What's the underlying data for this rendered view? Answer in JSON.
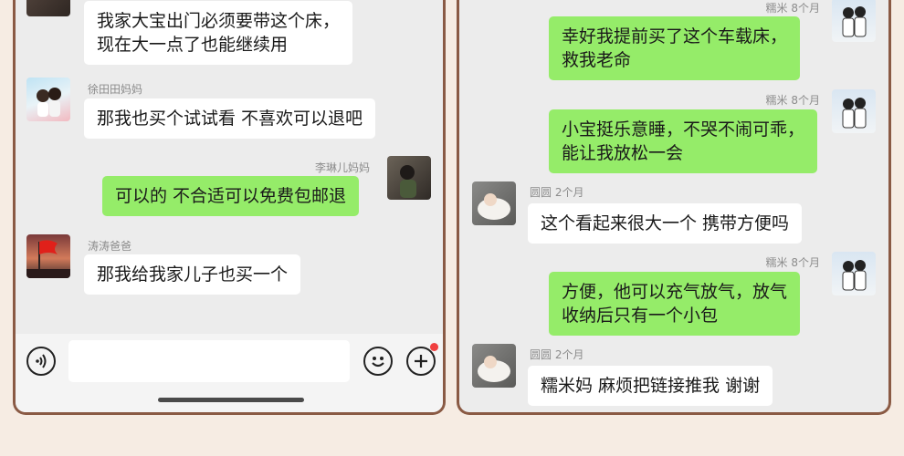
{
  "left_chat": {
    "messages": [
      {
        "sender": "",
        "text_lines": [
          "我家大宝出门必须要带这个床，",
          "现在大一点了也能继续用"
        ],
        "side": "left"
      },
      {
        "sender": "徐田田妈妈",
        "text": "那我也买个试试看 不喜欢可以退吧",
        "side": "left"
      },
      {
        "sender": "李琳儿妈妈",
        "text": "可以的 不合适可以免费包邮退",
        "side": "right"
      },
      {
        "sender": "涛涛爸爸",
        "text": "那我给我家儿子也买一个",
        "side": "left"
      }
    ],
    "input": {
      "placeholder": ""
    }
  },
  "right_chat": {
    "messages": [
      {
        "sender": "糯米 8个月",
        "text_lines": [
          "幸好我提前买了这个车载床，",
          "救我老命"
        ],
        "side": "right"
      },
      {
        "sender": "糯米 8个月",
        "text_lines": [
          "小宝挺乐意睡，不哭不闹可乖，",
          "能让我放松一会"
        ],
        "side": "right"
      },
      {
        "sender": "圆圆  2个月",
        "text": "这个看起来很大一个 携带方便吗",
        "side": "left"
      },
      {
        "sender": "糯米 8个月",
        "text_lines": [
          "方便，他可以充气放气，放气",
          "收纳后只有一个小包"
        ],
        "side": "right"
      },
      {
        "sender": "圆圆  2个月",
        "text": "糯米妈 麻烦把链接推我 谢谢",
        "side": "left"
      }
    ]
  },
  "icons": [
    "voice-icon",
    "emoji-icon",
    "plus-icon"
  ],
  "colors": {
    "page_bg": "#f6ece3",
    "frame": "#8a5a44",
    "chat_bg": "#ececec",
    "bubble_green": "#95ec69",
    "bubble_white": "#ffffff",
    "notification_dot": "#f04040"
  }
}
